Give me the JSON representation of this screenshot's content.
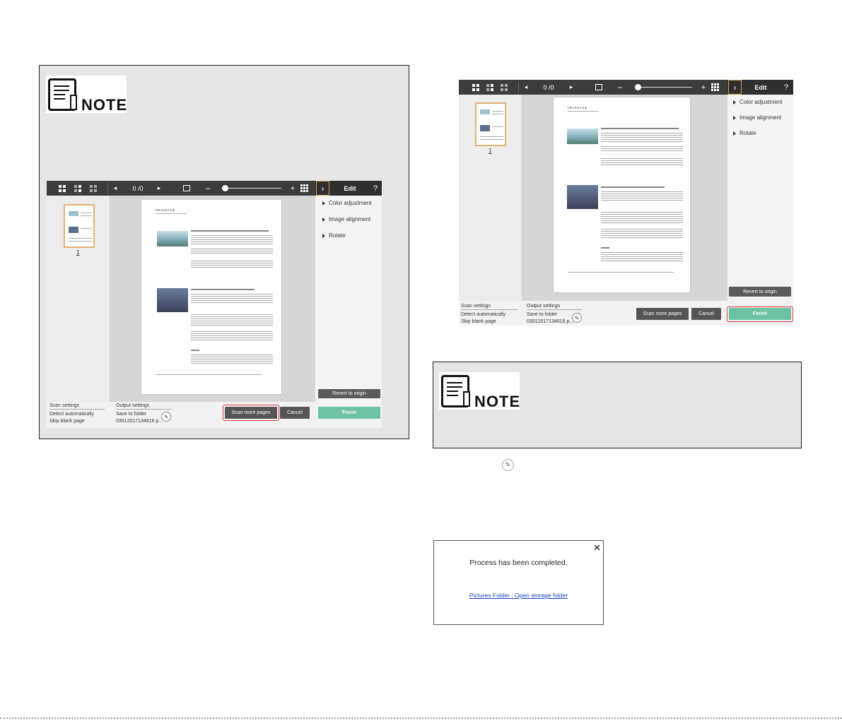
{
  "note": {
    "label": "NOTE"
  },
  "app": {
    "page_counter": "0 /0",
    "edit_title": "Edit",
    "help": "?",
    "thumb_number": "1",
    "menu": [
      "Color adjustment",
      "Image alignment",
      "Rotate"
    ],
    "revert_label": "Revert to origin",
    "scan_settings_label": "Scan settings",
    "detect": "Detect automatically",
    "skip_blank": "Skip blank page",
    "output_settings_label": "Output settings",
    "save_to": "Save to folder",
    "filename": "03012017134616.p...",
    "scan_more": "Scan more pages",
    "cancel": "Cancel",
    "finish": "Finish",
    "doc_header": "ʇʍɹʌʉʏʐʑ"
  },
  "dialog": {
    "message": "Process has been completed.",
    "link": "Pictures Folder : Open storage folder",
    "close": "✕"
  },
  "colors": {
    "finish_green": "#6cc2a2",
    "toolbar": "#3c3c3c",
    "highlight_red": "#d83a3a",
    "thumb_border": "#e2b374"
  }
}
